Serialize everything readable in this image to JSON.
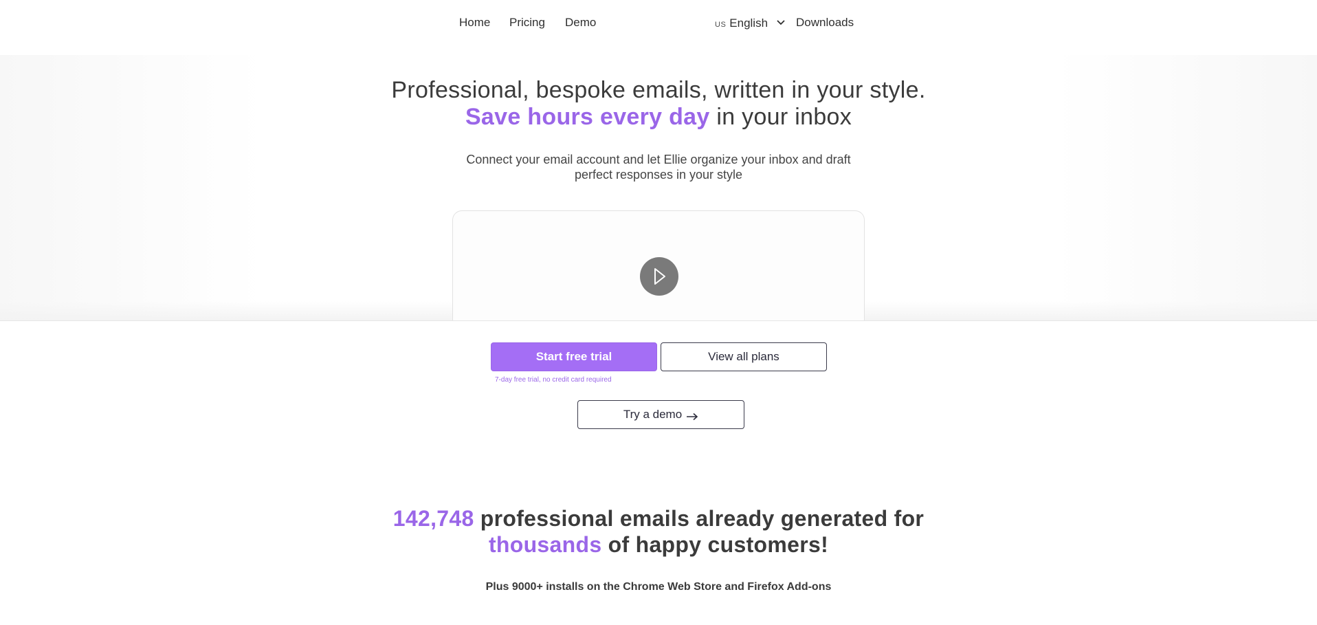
{
  "nav": {
    "home": "Home",
    "pricing": "Pricing",
    "demo": "Demo",
    "language_code": "US",
    "language_label": "English",
    "downloads": "Downloads"
  },
  "hero": {
    "title_part1": "Professional, bespoke emails, written in your style.",
    "title_accent": "Save hours every day",
    "title_part2": "in your inbox",
    "subtitle": "Connect your email account and let Ellie organize your inbox and draft perfect responses in your style",
    "video_play_icon": "play-icon"
  },
  "cta": {
    "start_trial": "Start free trial",
    "view_plans": "View all plans",
    "trial_note": "7-day free trial, no credit card required",
    "try_demo": "Try a demo"
  },
  "stats": {
    "count": "142,748",
    "text_part1": "professional emails already generated for",
    "accent_word": "thousands",
    "text_part2": "of happy customers!",
    "subtitle": "Plus 9000+ installs on the Chrome Web Store and Firefox Add-ons"
  },
  "colors": {
    "accent": "#9a66e8",
    "primary_button": "#a46ef5",
    "text_dark": "#3b3b3b"
  }
}
